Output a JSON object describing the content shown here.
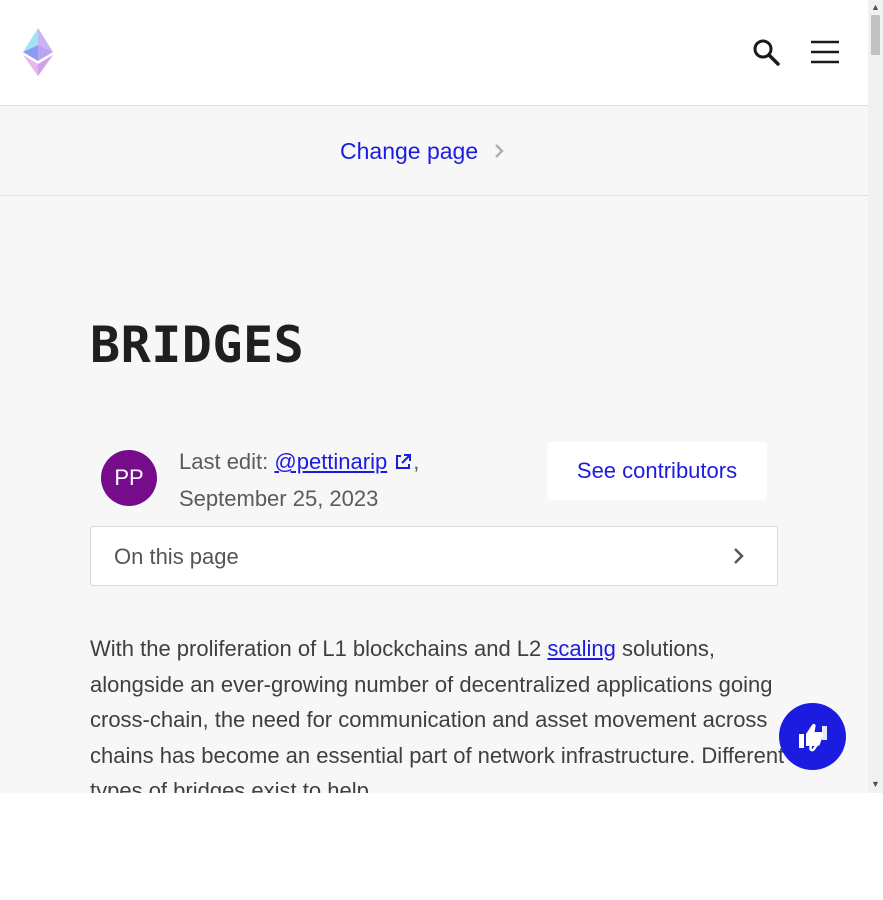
{
  "header": {
    "logo_icon": "ethereum-logo-icon",
    "search_icon": "search-icon",
    "menu_icon": "hamburger-menu-icon"
  },
  "change_page": {
    "label": "Change page",
    "icon": "chevron-right-icon"
  },
  "page": {
    "title": "BRIDGES"
  },
  "author": {
    "avatar_initials": "PP",
    "avatar_color": "#760c8c",
    "last_edit_prefix": "Last edit: ",
    "handle": "@pettinarip",
    "separator": ",",
    "date": "September 25, 2023",
    "external_icon": "external-link-icon"
  },
  "contributors_button": {
    "label": "See contributors"
  },
  "toc": {
    "label": "On this page",
    "icon": "chevron-right-icon"
  },
  "intro": {
    "text_before_link": "With the proliferation of L1 blockchains and L2 ",
    "link_text": "scaling",
    "text_after_link": " solutions, alongside an ever-growing number of decentralized applications going cross-chain, the need for communication and asset movement across chains has become an essential part of network infrastructure. Different types of bridges exist to help"
  },
  "feedback": {
    "icon": "thumbs-feedback-icon"
  },
  "colors": {
    "accent": "#1c1ce1",
    "background": "#f7f7f7",
    "text": "#3f3f3f"
  }
}
